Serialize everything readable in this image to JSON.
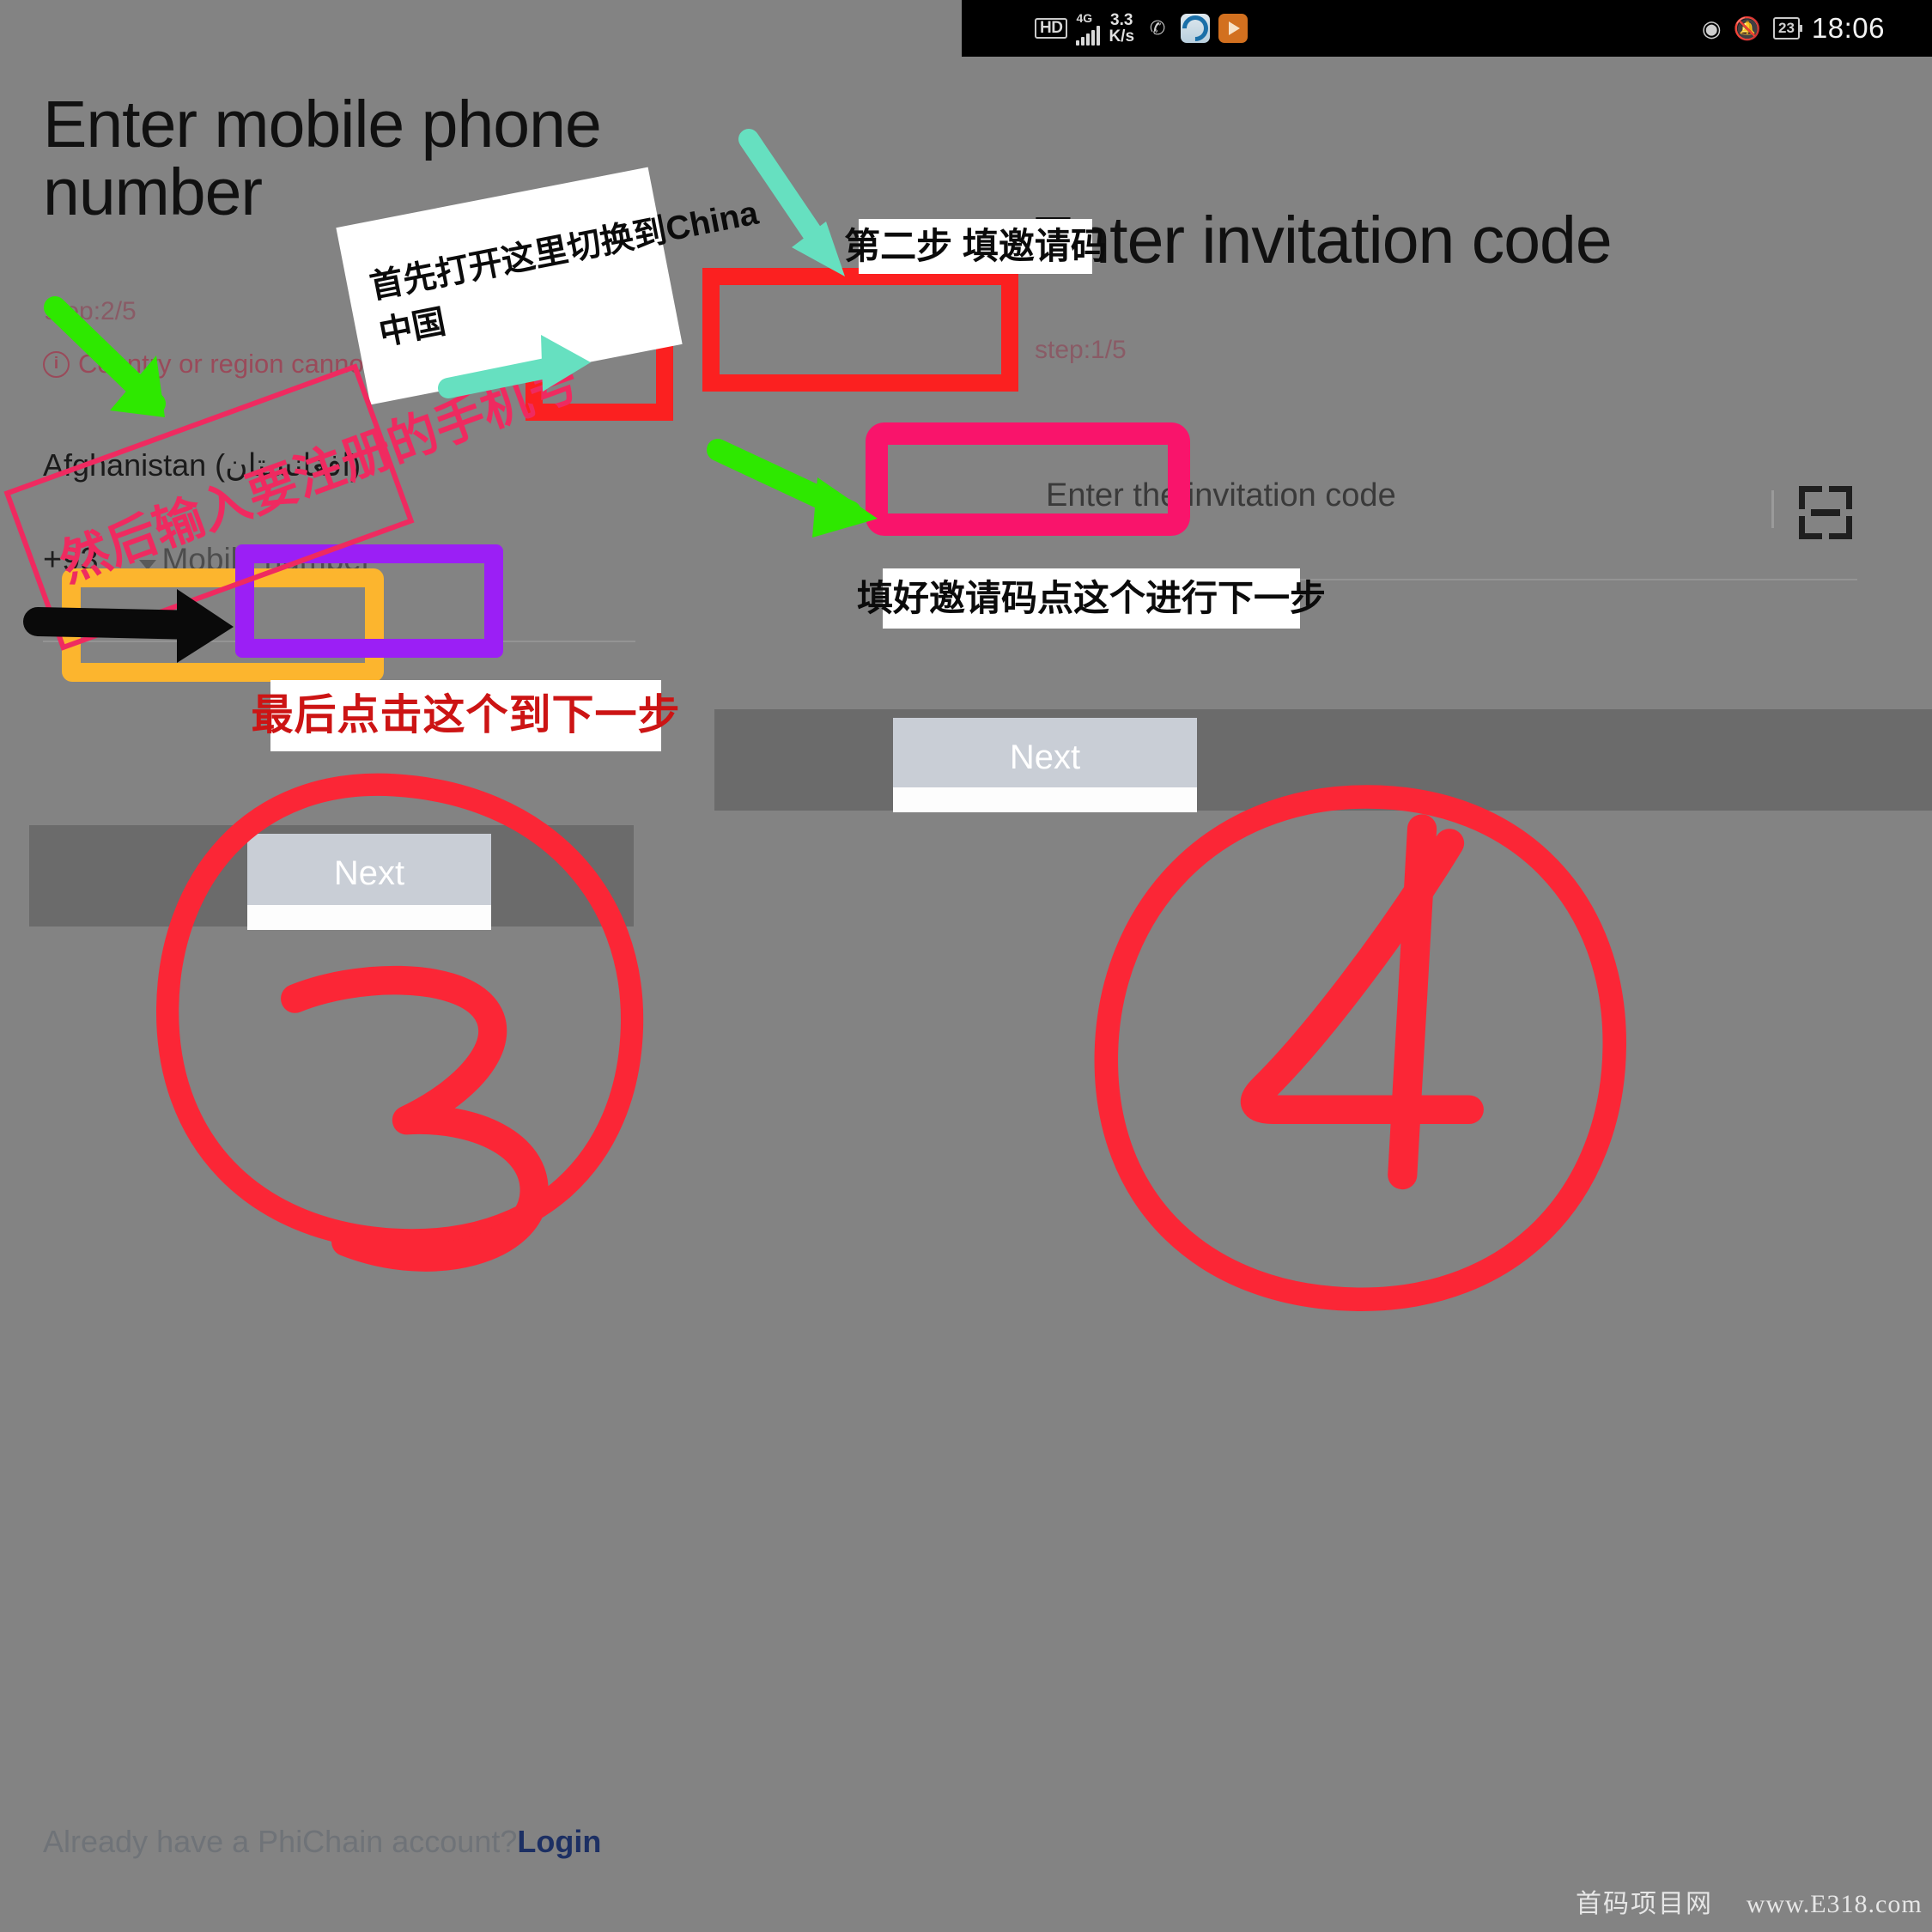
{
  "status_bar": {
    "hd_badge": "HD",
    "network_type": "4G",
    "data_speed": "3.3\nK/s",
    "data_speed_value": "3.3",
    "data_speed_unit": "K/s",
    "app_icons": [
      "wechat-icon",
      "browser-icon",
      "player-icon"
    ],
    "eye_icon": "eye-comfort-icon",
    "mute_icon": "bell-muted-icon",
    "battery_percent": "23",
    "clock": "18:06"
  },
  "left_screen": {
    "title": "Enter mobile phone number",
    "step": "step:1/5",
    "step_text": "step:2/5",
    "notice": "Country or region cannot be changed",
    "country": "Afghanistan (افغانستان)",
    "dial_code": "+93",
    "phone_placeholder": "Mobile number",
    "next_label": "Next",
    "login_prompt": "Already have a PhiChain account?",
    "login_link": "Login"
  },
  "right_screen": {
    "title": "Enter invitation code",
    "step_text": "step:1/5",
    "invitation_placeholder": "Enter the invitation code",
    "scan_icon": "scan-qr-icon",
    "next_label": "Next"
  },
  "annotations": {
    "note_switch_china_line1": "首先打开这里切换到China",
    "note_switch_china_line2": "中国",
    "strike_enter_phone": "然后输入要注册的手机号",
    "note_click_next_left": "最后点击这个到下一步",
    "note_step_two": "第二步 填邀请码",
    "note_click_next_right": "填好邀请码点这个进行下一步",
    "circle_number_left": "3",
    "circle_number_right": "4"
  },
  "watermark": {
    "site_name": "首码项目网",
    "url": "www.E318.com"
  },
  "colors": {
    "background": "#838383",
    "highlight_red": "#fb2020",
    "highlight_orange": "#fcb52e",
    "highlight_purple": "#9b1ff5",
    "highlight_pink": "#f9146b",
    "arrow_green": "#2ee800",
    "arrow_teal": "#66e0c0",
    "arrow_black": "#0a0a0a",
    "circle_red": "#fb2636",
    "note_red_text": "#cc1414",
    "login_link": "#1c2f63"
  }
}
